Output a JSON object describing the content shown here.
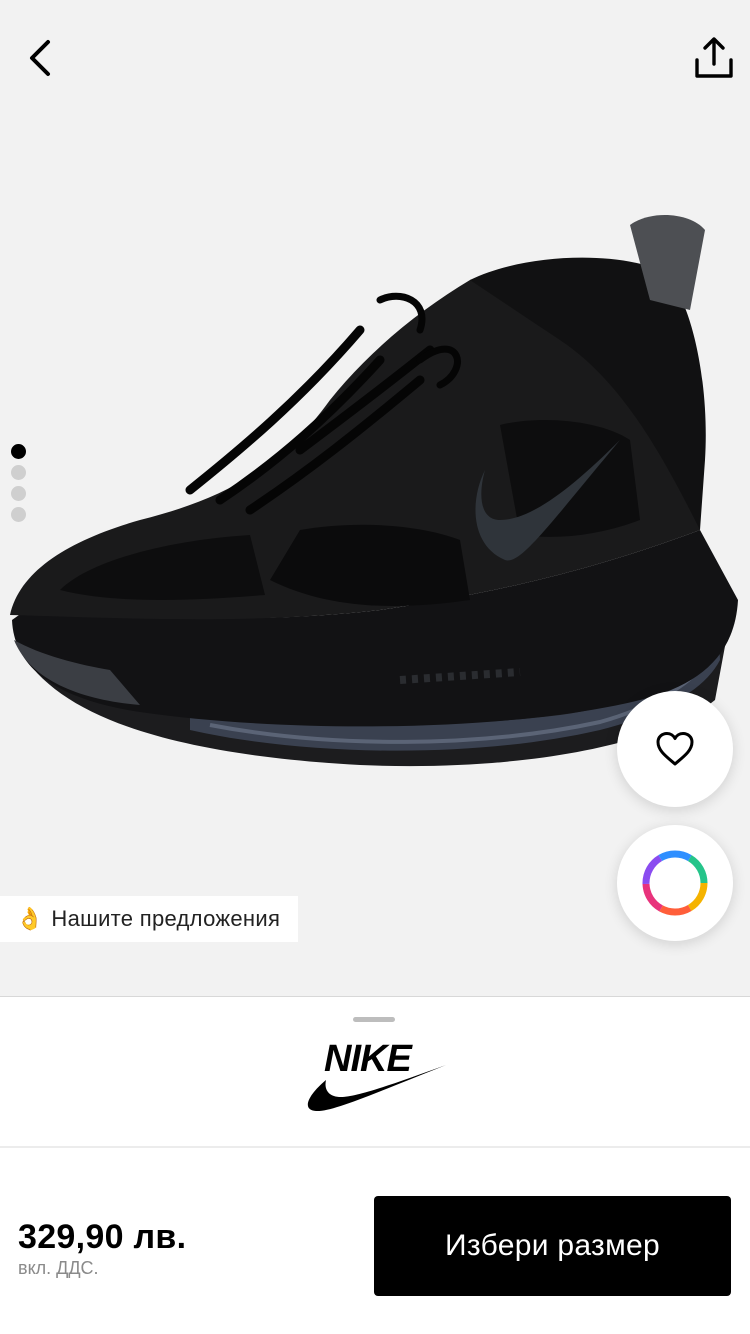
{
  "header": {
    "back_icon": "chevron-left-icon",
    "share_icon": "share-upload-icon"
  },
  "gallery": {
    "slide_count": 4,
    "active_index": 0
  },
  "actions": {
    "wishlist_icon": "heart-outline-icon",
    "color_icon": "color-wheel-icon"
  },
  "recommendations": {
    "emoji": "👌",
    "label": "Нашите предложения"
  },
  "brand": {
    "name": "NIKE",
    "logo_icon": "nike-swoosh-logo"
  },
  "purchase": {
    "price": "329,90 лв.",
    "vat_note": "вкл. ДДС.",
    "cta_label": "Избери размер"
  },
  "colors": {
    "hero_bg": "#f2f2f2",
    "cta_bg": "#000000",
    "cta_text": "#ffffff"
  }
}
